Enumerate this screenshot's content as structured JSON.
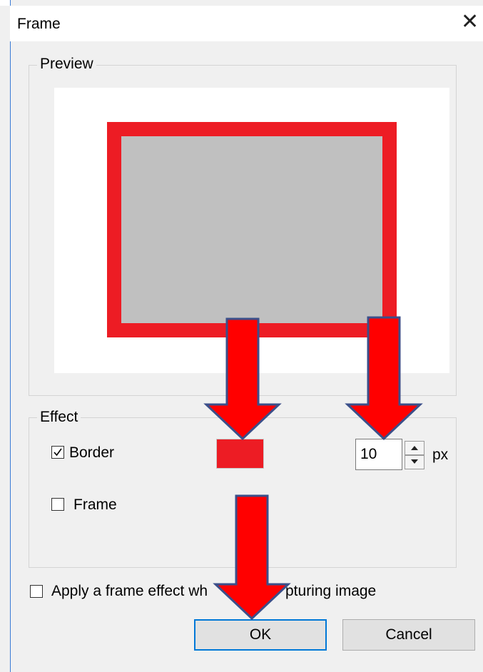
{
  "dialog": {
    "title": "Frame",
    "close_icon": "close-icon"
  },
  "preview": {
    "group_label": "Preview",
    "frame_color": "#ed1c24",
    "inner_color": "#c0c0c0"
  },
  "effect": {
    "group_label": "Effect",
    "border": {
      "label": "Border",
      "checked": true
    },
    "border_color": "#ed1c24",
    "border_width": "10",
    "unit": "px",
    "frame": {
      "label": "Frame",
      "checked": false
    }
  },
  "options": {
    "apply_on_capture_label": "Apply a frame effect wh",
    "apply_on_capture_label_tail": "pturing image",
    "apply_on_capture_checked": false
  },
  "buttons": {
    "ok": "OK",
    "cancel": "Cancel"
  },
  "annotation_arrow_color": "#ff0000"
}
